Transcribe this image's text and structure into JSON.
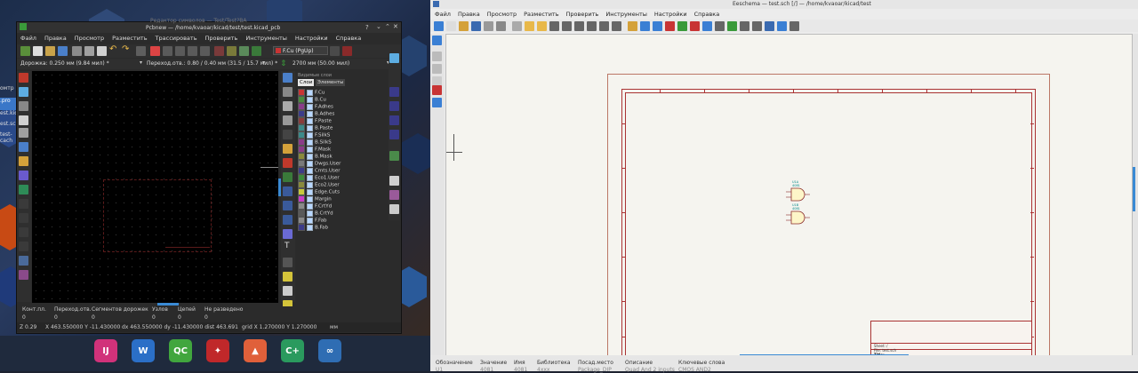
{
  "desktop": {
    "left_items": [
      "омтр",
      ".pro",
      "est.kicad",
      "est.sch",
      "test-cach"
    ]
  },
  "pcbnew": {
    "title": "Pcbnew — /home/kvaoar/kicad/test/test.kicad_pcb",
    "behind_title": "Редактор символов — Test/Test?BA",
    "menu": [
      "Файл",
      "Правка",
      "Просмотр",
      "Разместить",
      "Трассировать",
      "Проверить",
      "Инструменты",
      "Настройки",
      "Справка"
    ],
    "layer_select": "F.Cu (PgUp)",
    "track_label": "Дорожка: 0.250 мм (9.84 мил) *",
    "via_label": "Переход.отв.: 0.80 / 0.40 мм (31.5 / 15.7 мил) *",
    "grid_label": "2700 мм (50.00 мил)",
    "panel_title": "Видимые слои",
    "tabs": [
      "Слои",
      "Элементы"
    ],
    "layers": [
      {
        "name": "F.Cu",
        "color": "#c83434"
      },
      {
        "name": "B.Cu",
        "color": "#4a8a3c"
      },
      {
        "name": "F.Adhes",
        "color": "#8a3c8a"
      },
      {
        "name": "B.Adhes",
        "color": "#3c3c8a"
      },
      {
        "name": "F.Paste",
        "color": "#8a3c3c"
      },
      {
        "name": "B.Paste",
        "color": "#3c8a8a"
      },
      {
        "name": "F.SilkS",
        "color": "#3c8a8a"
      },
      {
        "name": "B.SilkS",
        "color": "#8a3c8a"
      },
      {
        "name": "F.Mask",
        "color": "#8a3c8a"
      },
      {
        "name": "B.Mask",
        "color": "#8a8a3c"
      },
      {
        "name": "Dwgs.User",
        "color": "#7a7a7a"
      },
      {
        "name": "Cmts.User",
        "color": "#3c3c8a"
      },
      {
        "name": "Eco1.User",
        "color": "#3c8a3c"
      },
      {
        "name": "Eco2.User",
        "color": "#8a8a3c"
      },
      {
        "name": "Edge.Cuts",
        "color": "#c8c83c"
      },
      {
        "name": "Margin",
        "color": "#c83cc8"
      },
      {
        "name": "F.CrtYd",
        "color": "#8a8a8a"
      },
      {
        "name": "B.CrtYd",
        "color": "#5a5a5a"
      },
      {
        "name": "F.Fab",
        "color": "#8a8a8a"
      },
      {
        "name": "B.Fab",
        "color": "#3c3c8a"
      }
    ],
    "stats": {
      "headers": [
        "Конт.пл.",
        "Переход.отв.",
        "Сегментов дорожек",
        "Узлов",
        "Цепей",
        "Не разведено"
      ],
      "values": [
        "0",
        "0",
        "0",
        "0",
        "0",
        "0"
      ]
    },
    "statusbar": {
      "zoom": "Z 0.29",
      "xy": "X 463.550000  Y -11.430000",
      "dxy": "dx 463.550000  dy -11.430000  dist 463.691",
      "grid": "grid X 1.270000  Y 1.270000",
      "units": "мм"
    }
  },
  "taskbar": {
    "apps": [
      {
        "name": "IntelliJ",
        "label": "IJ",
        "color": "#d1327a"
      },
      {
        "name": "Word",
        "label": "W",
        "color": "#2b6fc7"
      },
      {
        "name": "Qt",
        "label": "QC",
        "color": "#41a63e"
      },
      {
        "name": "Gravit",
        "label": "✦",
        "color": "#c0282a"
      },
      {
        "name": "Triangle",
        "label": "▲",
        "color": "#e0603a"
      },
      {
        "name": "CLion",
        "label": "C+",
        "color": "#2a9a5e"
      },
      {
        "name": "Octave",
        "label": "∞",
        "color": "#2f6db3"
      }
    ]
  },
  "eeschema": {
    "title": "Eeschema — test.sch [/] — /home/kvaoar/kicad/test",
    "menu": [
      "Файл",
      "Правка",
      "Просмотр",
      "Разместить",
      "Проверить",
      "Инструменты",
      "Настройки",
      "Справка"
    ],
    "symbols": [
      {
        "ref": "U1A",
        "value": "4081"
      },
      {
        "ref": "U1B",
        "value": "4081"
      }
    ],
    "title_block": {
      "sheet": "Sheet: /",
      "file": "File: test.sch",
      "title": "Title:"
    },
    "statusbar": {
      "headers": [
        "Обозначение",
        "Значение",
        "Имя",
        "Библиотека",
        "Посад.место",
        "Описание",
        "Ключевые слова"
      ],
      "values": [
        "U1",
        "4081",
        "4081",
        "4xxx",
        "Package_DIP",
        "Quad And 2 inputs",
        "CMOS AND2"
      ]
    }
  }
}
